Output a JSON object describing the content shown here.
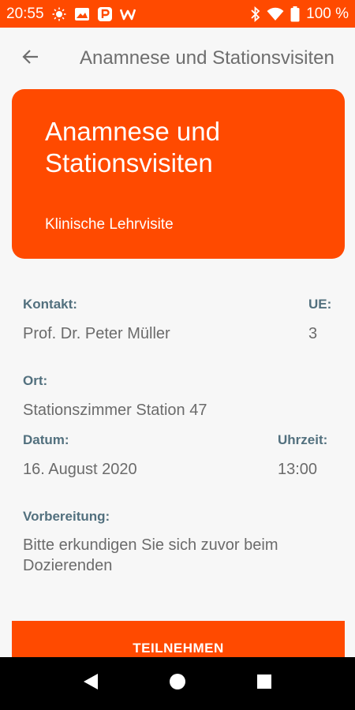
{
  "status_bar": {
    "time": "20:55",
    "battery_percent": "100 %",
    "left_icons": [
      "brightness-icon",
      "photo-icon",
      "p-app-icon",
      "w-app-icon"
    ],
    "right_icons": [
      "bluetooth-icon",
      "wifi-icon",
      "battery-icon"
    ]
  },
  "app_bar": {
    "title": "Anamnese und Stationsvisiten",
    "back_icon": "arrow-back-icon"
  },
  "hero": {
    "title": "Anamnese und Stationsvisiten",
    "subtitle": "Klinische Lehrvisite"
  },
  "details": {
    "contact_label": "Kontakt:",
    "contact_value": "Prof. Dr. Peter Müller",
    "ue_label": "UE:",
    "ue_value": "3",
    "location_label": "Ort:",
    "location_value": "Stationszimmer Station 47",
    "date_label": "Datum:",
    "date_value": "16. August 2020",
    "time_label": "Uhrzeit:",
    "time_value": "13:00",
    "preparation_label": "Vorbereitung:",
    "preparation_value": "Bitte erkundigen Sie sich zuvor beim Dozierenden"
  },
  "actions": {
    "join_label": "TEILNEHMEN"
  },
  "colors": {
    "accent": "#ff4a00",
    "label": "#52707e",
    "value": "#6b6b6b"
  }
}
